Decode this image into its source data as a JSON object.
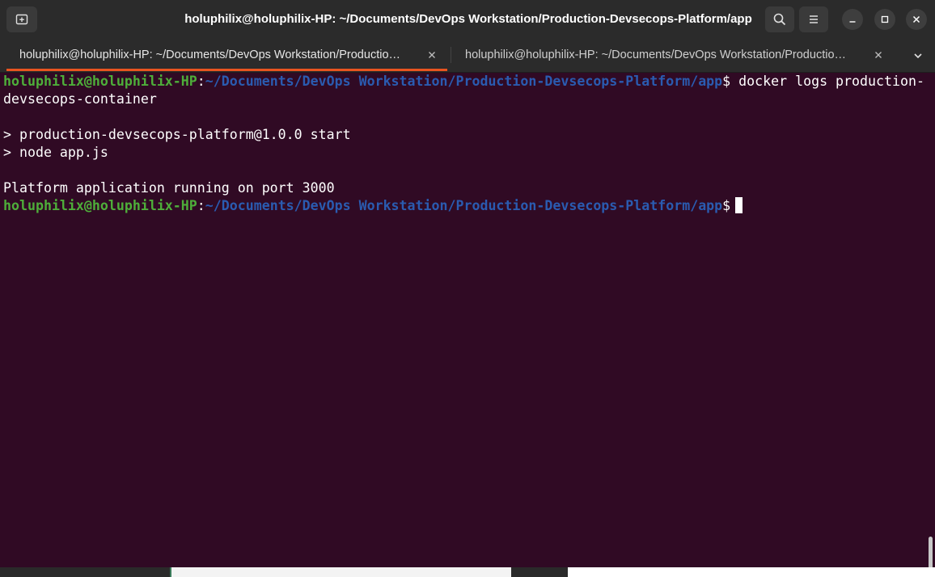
{
  "window": {
    "title": "holuphilix@holuphilix-HP: ~/Documents/DevOps Workstation/Production-Devsecops-Platform/app"
  },
  "icons": {
    "new_tab": "new-tab-icon",
    "search": "search-icon",
    "menu": "hamburger-menu-icon",
    "minimize": "minimize-icon",
    "maximize": "maximize-icon",
    "close": "close-icon",
    "tab_close": "close-icon",
    "tab_list": "chevron-down-icon"
  },
  "tabs": [
    {
      "label": "holuphilix@holuphilix-HP: ~/Documents/DevOps Workstation/Productio…",
      "active": true
    },
    {
      "label": "holuphilix@holuphilix-HP: ~/Documents/DevOps Workstation/Productio…",
      "active": false
    }
  ],
  "terminal": {
    "prompt_user": "holuphilix@holuphilix-HP",
    "prompt_colon": ":",
    "prompt_path": "~/Documents/DevOps Workstation/Production-Devsecops-Platform/app",
    "prompt_dollar": "$",
    "command": " docker logs production-",
    "command_wrap": "devsecops-container",
    "output": [
      "",
      "> production-devsecops-platform@1.0.0 start",
      "> node app.js",
      "",
      "Platform application running on port 3000"
    ]
  },
  "colors": {
    "terminal_bg": "#300a24",
    "prompt_user": "#4eae3a",
    "prompt_path": "#2a5bb0",
    "accent_tab": "#e95420",
    "titlebar_bg": "#2b2b2b"
  }
}
